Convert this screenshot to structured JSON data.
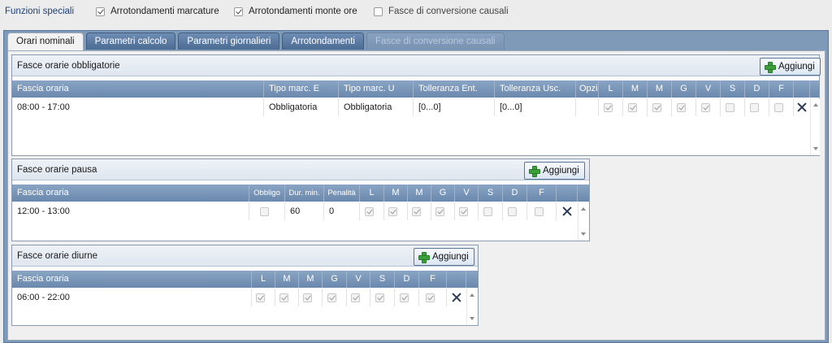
{
  "options": {
    "title": "Funzioni speciali",
    "items": [
      {
        "label": "Arrotondamenti marcature",
        "checked": true
      },
      {
        "label": "Arrotondamenti monte ore",
        "checked": true
      },
      {
        "label": "Fasce di conversione causali",
        "checked": false
      }
    ]
  },
  "tabs": [
    {
      "label": "Orari nominali",
      "state": "active"
    },
    {
      "label": "Parametri calcolo",
      "state": "normal"
    },
    {
      "label": "Parametri giornalieri",
      "state": "normal"
    },
    {
      "label": "Arrotondamenti",
      "state": "normal"
    },
    {
      "label": "Fasce di conversione causali",
      "state": "disabled"
    }
  ],
  "obbligatorie": {
    "title": "Fasce orarie obbligatorie",
    "add_label": "Aggiungi",
    "headers": [
      "Fascia oraria",
      "Tipo marc. E",
      "Tipo marc. U",
      "Tolleranza Ent.",
      "Tolleranza Usc.",
      "Opzi",
      "L",
      "M",
      "M",
      "G",
      "V",
      "S",
      "D",
      "F"
    ],
    "rows": [
      {
        "fascia": "08:00 - 17:00",
        "tipo_e": "Obbligatoria",
        "tipo_u": "Obbligatoria",
        "toll_ent": "[0...0]",
        "toll_usc": "[0...0]",
        "days": [
          true,
          true,
          true,
          true,
          true,
          false,
          false,
          false
        ]
      }
    ]
  },
  "pausa": {
    "title": "Fasce orarie pausa",
    "add_label": "Aggiungi",
    "headers": [
      "Fascia oraria",
      "Obbligo",
      "Dur. min.",
      "Penalità",
      "L",
      "M",
      "M",
      "G",
      "V",
      "S",
      "D",
      "F"
    ],
    "rows": [
      {
        "fascia": "12:00 - 13:00",
        "obbligo": false,
        "dur_min": "60",
        "penalita": "0",
        "days": [
          true,
          true,
          true,
          true,
          true,
          false,
          false,
          false
        ]
      }
    ]
  },
  "diurne": {
    "title": "Fasce orarie diurne",
    "add_label": "Aggiungi",
    "headers": [
      "Fascia oraria",
      "L",
      "M",
      "M",
      "G",
      "V",
      "S",
      "D",
      "F"
    ],
    "rows": [
      {
        "fascia": "06:00 - 22:00",
        "days": [
          true,
          true,
          true,
          true,
          true,
          true,
          true,
          true
        ]
      }
    ]
  }
}
